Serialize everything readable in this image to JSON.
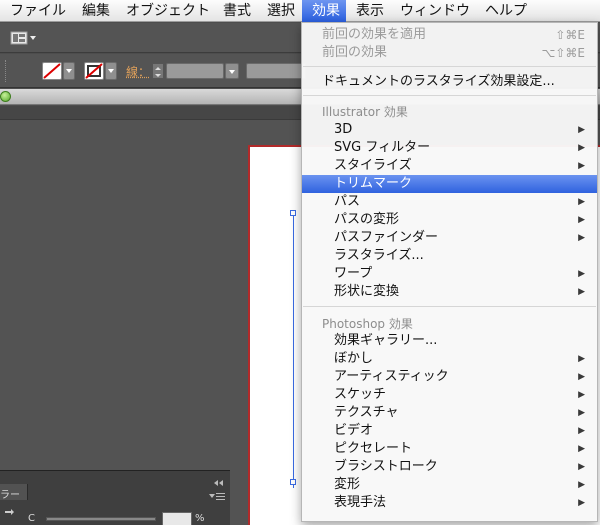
{
  "menubar": {
    "items": [
      {
        "label": "ファイル"
      },
      {
        "label": "編集"
      },
      {
        "label": "オブジェクト"
      },
      {
        "label": "書式"
      },
      {
        "label": "選択"
      },
      {
        "label": "効果"
      },
      {
        "label": "表示"
      },
      {
        "label": "ウィンドウ"
      },
      {
        "label": "ヘルプ"
      }
    ],
    "active_item": "効果"
  },
  "controlbar": {
    "stroke_label": "線："
  },
  "color_panel": {
    "tab_label": "ラー",
    "c_label": "C",
    "percent": "%"
  },
  "effects_menu": {
    "previous_apply": {
      "label": "前回の効果を適用",
      "shortcut": "⇧⌘E"
    },
    "previous": {
      "label": "前回の効果",
      "shortcut": "⌥⇧⌘E"
    },
    "document_raster": {
      "label": "ドキュメントのラスタライズ効果設定..."
    },
    "illustrator_header": "Illustrator 効果",
    "illustrator_items": [
      {
        "label": "3D",
        "submenu": true
      },
      {
        "label": "SVG フィルター",
        "submenu": true
      },
      {
        "label": "スタイライズ",
        "submenu": true
      },
      {
        "label": "トリムマーク",
        "submenu": false
      },
      {
        "label": "パス",
        "submenu": true
      },
      {
        "label": "パスの変形",
        "submenu": true
      },
      {
        "label": "パスファインダー",
        "submenu": true
      },
      {
        "label": "ラスタライズ...",
        "submenu": false
      },
      {
        "label": "ワープ",
        "submenu": true
      },
      {
        "label": "形状に変換",
        "submenu": true
      }
    ],
    "highlighted_item": "トリムマーク",
    "photoshop_header": "Photoshop 効果",
    "photoshop_items": [
      {
        "label": "効果ギャラリー...",
        "submenu": false
      },
      {
        "label": "ぼかし",
        "submenu": true
      },
      {
        "label": "アーティスティック",
        "submenu": true
      },
      {
        "label": "スケッチ",
        "submenu": true
      },
      {
        "label": "テクスチャ",
        "submenu": true
      },
      {
        "label": "ビデオ",
        "submenu": true
      },
      {
        "label": "ピクセレート",
        "submenu": true
      },
      {
        "label": "ブラシストローク",
        "submenu": true
      },
      {
        "label": "変形",
        "submenu": true
      },
      {
        "label": "表現手法",
        "submenu": true
      }
    ]
  },
  "colors": {
    "menu_highlight": "#3a6ae2",
    "artboard_border": "#b22a2a",
    "selection": "#3a6ae2"
  }
}
